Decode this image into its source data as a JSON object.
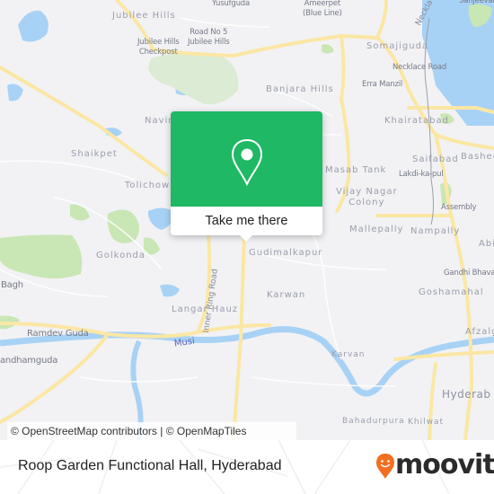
{
  "map": {
    "popup": {
      "icon": "map-pin-icon",
      "cta_label": "Take me there",
      "accent_color": "#1fb864"
    },
    "labels": {
      "districts": [
        {
          "id": "jubilee-hills",
          "text": "Jubilee Hills"
        },
        {
          "id": "banjara-hills",
          "text": "Banjara Hills"
        },
        {
          "id": "somajiguda",
          "text": "Somajiguda"
        },
        {
          "id": "khairatabad",
          "text": "Khairatabad"
        },
        {
          "id": "navin",
          "text": "Navin"
        },
        {
          "id": "shaikpet",
          "text": "Shaikpet"
        },
        {
          "id": "tolichowki",
          "text": "Tolichowki"
        },
        {
          "id": "masab-tank",
          "text": "Masab Tank"
        },
        {
          "id": "saifabad",
          "text": "Saifabad"
        },
        {
          "id": "basheer",
          "text": "Basheer"
        },
        {
          "id": "vijay-nagar-colony",
          "text": "Vijay Nagar\nColony"
        },
        {
          "id": "mallepally",
          "text": "Mallepally"
        },
        {
          "id": "nampally",
          "text": "Nampally"
        },
        {
          "id": "golkonda",
          "text": "Golkonda"
        },
        {
          "id": "gudimalkapur",
          "text": "Gudimalkapur"
        },
        {
          "id": "karwan",
          "text": "Karwan"
        },
        {
          "id": "goshamahal",
          "text": "Goshamahal"
        },
        {
          "id": "langar-hauz",
          "text": "Langar Hauz"
        },
        {
          "id": "karvan",
          "text": "Karvan"
        },
        {
          "id": "afzalgunj",
          "text": "Afzalg"
        },
        {
          "id": "abids",
          "text": "Abi"
        },
        {
          "id": "bahadurpura",
          "text": "Bahadurpura"
        },
        {
          "id": "khilwat",
          "text": "Khilwat"
        }
      ],
      "pois": [
        {
          "id": "yusufguda",
          "text": "Yusufguda"
        },
        {
          "id": "ameerpet",
          "text": "Ameerpet\n(Blue Line)"
        },
        {
          "id": "sanjeevaiah",
          "text": "Sanjeevai"
        },
        {
          "id": "road-no-5",
          "text": "Road No 5\nJubilee Hills"
        },
        {
          "id": "jubilee-checkpost",
          "text": "Jubilee Hills\nCheckpost"
        },
        {
          "id": "necklace-road",
          "text": "Necklace Road"
        },
        {
          "id": "erra-manzil",
          "text": "Erra Manzil"
        },
        {
          "id": "lakdi-ka-pul",
          "text": "Lakdi-ka-pul"
        },
        {
          "id": "assembly",
          "text": "Assembly"
        },
        {
          "id": "gandhi-bhavan",
          "text": "Gandhi Bhavan"
        },
        {
          "id": "ramdev-guda",
          "text": "Ramdev Guda"
        },
        {
          "id": "bandhamguda",
          "text": "andhamguda"
        },
        {
          "id": "bagh",
          "text": "Bagh"
        }
      ],
      "roads": [
        {
          "id": "inner-ring-road",
          "text": "Inner Ring Road"
        },
        {
          "id": "necklace",
          "text": "Neckla"
        }
      ],
      "rivers": [
        {
          "id": "musi",
          "text": "Musi"
        }
      ],
      "cities": [
        {
          "id": "hyderabad",
          "text": "Hyderab"
        }
      ]
    },
    "attribution": "© OpenStreetMap contributors | © OpenMapTiles"
  },
  "footer": {
    "place_name": "Roop Garden Functional Hall, Hyderabad",
    "brand": "moovit",
    "brand_icon": "moovit-smiley-pin-icon",
    "brand_color": "#f26f21"
  }
}
